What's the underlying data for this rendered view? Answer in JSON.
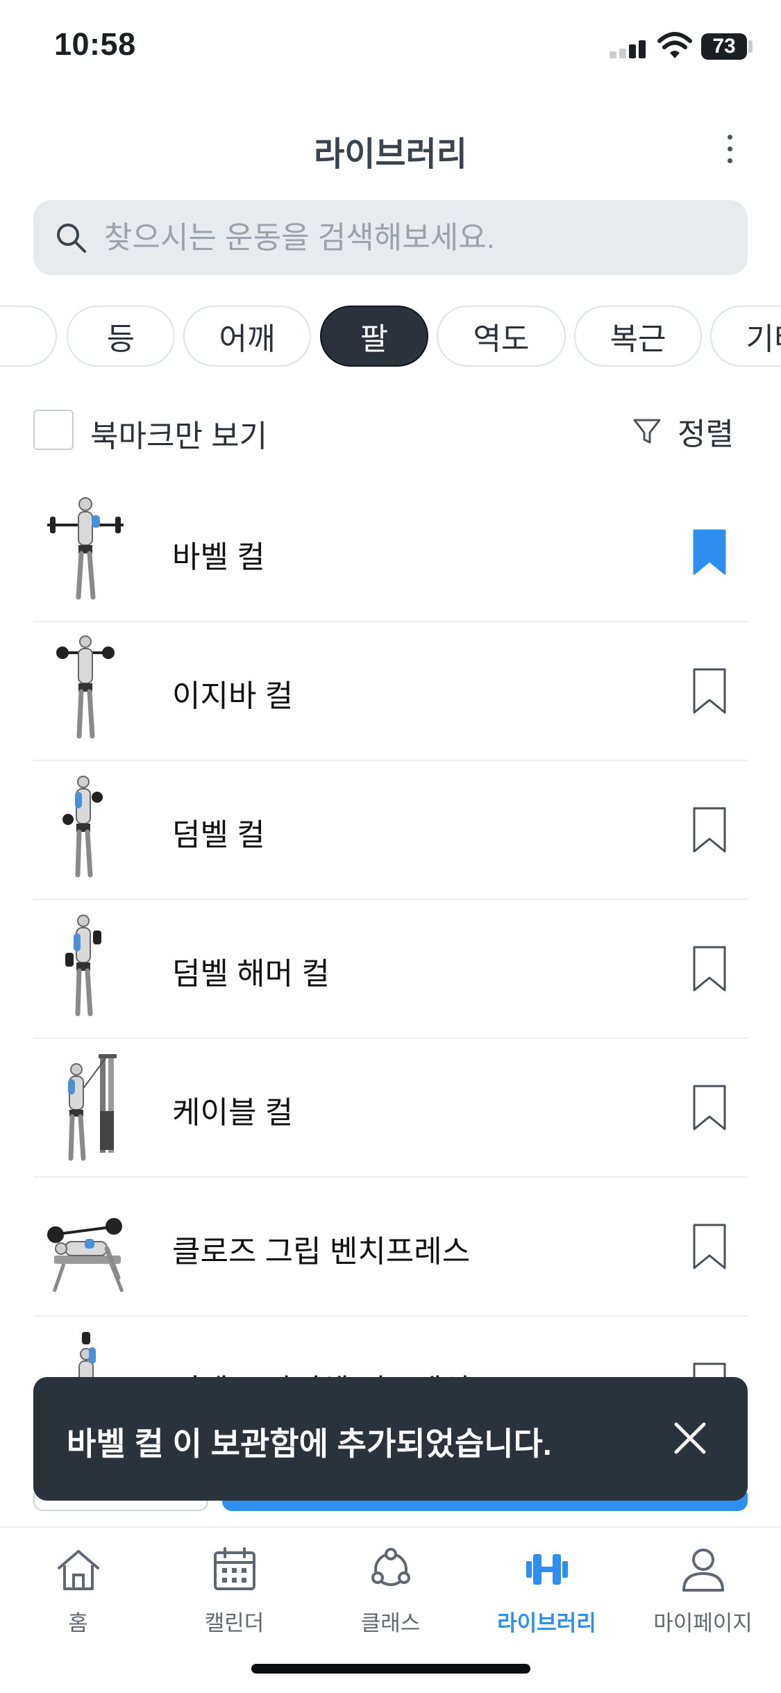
{
  "status_bar": {
    "time": "10:58",
    "battery": "73"
  },
  "header": {
    "title": "라이브러리"
  },
  "search": {
    "placeholder": "찾으시는 운동을 검색해보세요."
  },
  "categories": {
    "items": [
      "",
      "등",
      "어깨",
      "팔",
      "역도",
      "복근",
      "기타"
    ],
    "selected": "팔"
  },
  "filter": {
    "bookmark_only_label": "북마크만 보기",
    "bookmark_only_checked": false,
    "sort_label": "정렬"
  },
  "exercises": [
    {
      "name": "바벨 컬",
      "bookmarked": true
    },
    {
      "name": "이지바 컬",
      "bookmarked": false
    },
    {
      "name": "덤벨 컬",
      "bookmarked": false
    },
    {
      "name": "덤벨 해머 컬",
      "bookmarked": false
    },
    {
      "name": "케이블 컬",
      "bookmarked": false
    },
    {
      "name": "클로즈 그립 벤치프레스",
      "bookmarked": false
    },
    {
      "name": "덤벨 트라이셉 익스텐션",
      "bookmarked": false
    }
  ],
  "toast": {
    "message": "바벨 컬 이 보관함에 추가되었습니다."
  },
  "tab_bar": {
    "items": [
      {
        "label": "홈",
        "icon": "home-icon"
      },
      {
        "label": "캘린더",
        "icon": "calendar-icon"
      },
      {
        "label": "클래스",
        "icon": "class-network-icon"
      },
      {
        "label": "라이브러리",
        "icon": "dumbbell-icon"
      },
      {
        "label": "마이페이지",
        "icon": "person-icon"
      }
    ],
    "active": "라이브러리"
  },
  "colors": {
    "accent": "#2e8ff0",
    "dark": "#2a323b",
    "chip_active": "#2b323b",
    "search_bg": "#e8ebee"
  }
}
